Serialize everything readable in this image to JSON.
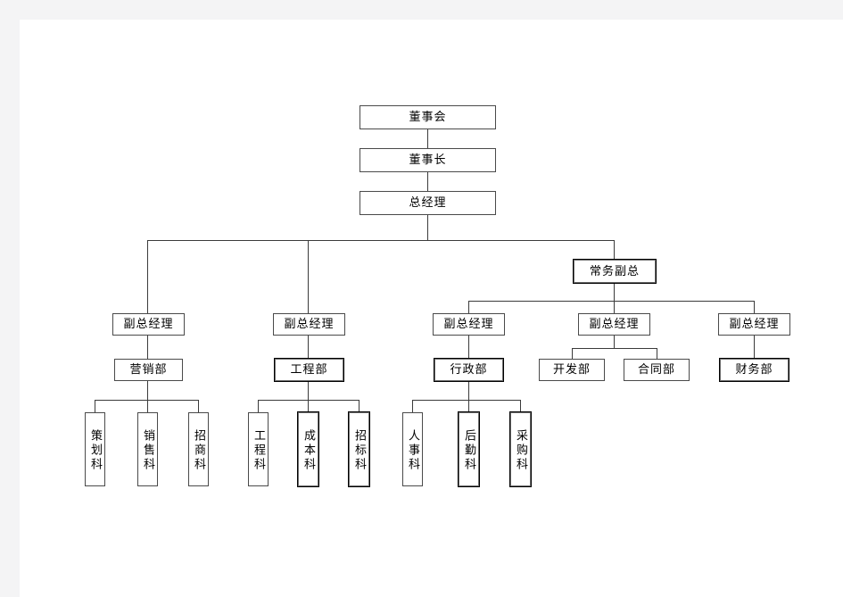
{
  "document": {
    "title": "组织结构图",
    "page_background": "#ffffff",
    "canvas_background": "#f4f4f5",
    "line_color": "#3b3b3b",
    "box_border_color": "#4a4a4a",
    "text_color": "#000000"
  },
  "chart_data": {
    "type": "diagram",
    "subtype": "organizational-chart",
    "orientation": "top-down",
    "title": "",
    "levels": 5,
    "nodes": [
      {
        "id": "n1",
        "label": "董事会",
        "level": 1,
        "parent": null
      },
      {
        "id": "n2",
        "label": "董事长",
        "level": 2,
        "parent": "n1"
      },
      {
        "id": "n3",
        "label": "总经理",
        "level": 3,
        "parent": "n2"
      },
      {
        "id": "n4",
        "label": "常务副总",
        "level": 4,
        "parent": "n3"
      },
      {
        "id": "n5",
        "label": "副总经理",
        "level": 5,
        "parent": "n3"
      },
      {
        "id": "n6",
        "label": "副总经理",
        "level": 5,
        "parent": "n3"
      },
      {
        "id": "n7",
        "label": "副总经理",
        "level": 5,
        "parent": "n4"
      },
      {
        "id": "n8",
        "label": "副总经理",
        "level": 5,
        "parent": "n4"
      },
      {
        "id": "n9",
        "label": "副总经理",
        "level": 5,
        "parent": "n4"
      },
      {
        "id": "n10",
        "label": "营销部",
        "level": 6,
        "parent": "n5"
      },
      {
        "id": "n11",
        "label": "工程部",
        "level": 6,
        "parent": "n6"
      },
      {
        "id": "n12",
        "label": "行政部",
        "level": 6,
        "parent": "n7"
      },
      {
        "id": "n13",
        "label": "开发部",
        "level": 6,
        "parent": "n8"
      },
      {
        "id": "n14",
        "label": "合同部",
        "level": 6,
        "parent": "n8"
      },
      {
        "id": "n15",
        "label": "财务部",
        "level": 6,
        "parent": "n9"
      },
      {
        "id": "n16",
        "label": "策划科",
        "level": 7,
        "parent": "n10"
      },
      {
        "id": "n17",
        "label": "销售科",
        "level": 7,
        "parent": "n10"
      },
      {
        "id": "n18",
        "label": "招商科",
        "level": 7,
        "parent": "n10"
      },
      {
        "id": "n19",
        "label": "工程科",
        "level": 7,
        "parent": "n11"
      },
      {
        "id": "n20",
        "label": "成本科",
        "level": 7,
        "parent": "n11"
      },
      {
        "id": "n21",
        "label": "招标科",
        "level": 7,
        "parent": "n11"
      },
      {
        "id": "n22",
        "label": "人事科",
        "level": 7,
        "parent": "n12"
      },
      {
        "id": "n23",
        "label": "后勤科",
        "level": 7,
        "parent": "n12"
      },
      {
        "id": "n24",
        "label": "采购科",
        "level": 7,
        "parent": "n12"
      }
    ]
  },
  "nodes": {
    "board": {
      "label": "董事会"
    },
    "chairman": {
      "label": "董事长"
    },
    "general_manager": {
      "label": "总经理"
    },
    "exec_vp": {
      "label": "常务副总"
    },
    "vp1": {
      "label": "副总经理"
    },
    "vp2": {
      "label": "副总经理"
    },
    "vp3": {
      "label": "副总经理"
    },
    "vp4": {
      "label": "副总经理"
    },
    "vp5": {
      "label": "副总经理"
    },
    "dept_marketing": {
      "label": "营销部"
    },
    "dept_engineering": {
      "label": "工程部"
    },
    "dept_admin": {
      "label": "行政部"
    },
    "dept_development": {
      "label": "开发部"
    },
    "dept_contract": {
      "label": "合同部"
    },
    "dept_finance": {
      "label": "财务部"
    },
    "sec_planning": {
      "label": "策划科"
    },
    "sec_sales": {
      "label": "销售科"
    },
    "sec_investment": {
      "label": "招商科"
    },
    "sec_engineering": {
      "label": "工程科"
    },
    "sec_cost": {
      "label": "成本科"
    },
    "sec_bidding": {
      "label": "招标科"
    },
    "sec_hr": {
      "label": "人事科"
    },
    "sec_logistics": {
      "label": "后勤科"
    },
    "sec_purchasing": {
      "label": "采购科"
    }
  }
}
